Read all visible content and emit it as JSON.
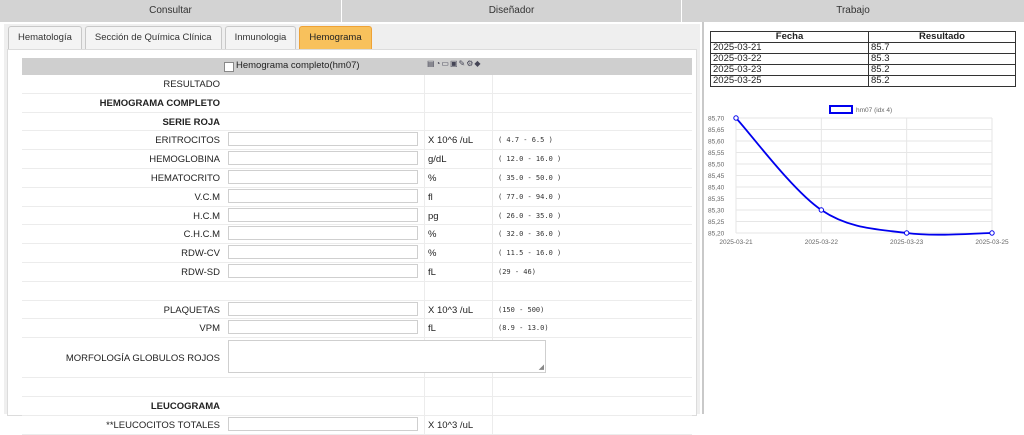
{
  "sections": [
    "Consultar",
    "Diseñador",
    "Trabajo"
  ],
  "tabs": [
    {
      "label": "Hematología"
    },
    {
      "label": "Sección de Química Clínica"
    },
    {
      "label": "Inmunologia"
    },
    {
      "label": "Hemograma"
    }
  ],
  "active_tab": "Hemograma",
  "form": {
    "title": "Hemograma completo(hm07)",
    "rows": [
      {
        "label": "RESULTADO",
        "bold": false,
        "type": "label"
      },
      {
        "label": "HEMOGRAMA COMPLETO",
        "bold": true,
        "type": "label"
      },
      {
        "label": "SERIE ROJA",
        "bold": true,
        "type": "label"
      },
      {
        "label": "ERITROCITOS",
        "type": "input",
        "unit": "X 10^6 /uL",
        "ref": "( 4.7 - 6.5 )"
      },
      {
        "label": "HEMOGLOBINA",
        "type": "input",
        "unit": "g/dL",
        "ref": "( 12.0 - 16.0 )"
      },
      {
        "label": "HEMATOCRITO",
        "type": "input",
        "unit": "%",
        "ref": "( 35.0 - 50.0 )"
      },
      {
        "label": "V.C.M",
        "type": "input",
        "unit": "fl",
        "ref": "( 77.0 - 94.0 )"
      },
      {
        "label": "H.C.M",
        "type": "input",
        "unit": "pg",
        "ref": "( 26.0 - 35.0 )"
      },
      {
        "label": "C.H.C.M",
        "type": "input",
        "unit": "%",
        "ref": "( 32.0 - 36.0 )"
      },
      {
        "label": "RDW-CV",
        "type": "input",
        "unit": "%",
        "ref": "( 11.5 - 16.0 )"
      },
      {
        "label": "RDW-SD",
        "type": "input",
        "unit": "fL",
        "ref": "(29 - 46)"
      },
      {
        "label": "",
        "type": "blank"
      },
      {
        "label": "PLAQUETAS",
        "type": "input",
        "unit": "X 10^3 /uL",
        "ref": "(150 - 500)"
      },
      {
        "label": "VPM",
        "type": "input",
        "unit": "fL",
        "ref": "(8.9 - 13.0)"
      },
      {
        "label": "MORFOLOGÍA GLOBULOS ROJOS",
        "type": "textarea"
      },
      {
        "label": "",
        "type": "blank"
      },
      {
        "label": "LEUCOGRAMA",
        "bold": true,
        "type": "label"
      },
      {
        "label": "**LEUCOCITOS TOTALES",
        "type": "input",
        "unit": "X 10^3 /uL",
        "ref": ""
      }
    ]
  },
  "results": {
    "headers": [
      "Fecha",
      "Resultado"
    ],
    "rows": [
      [
        "2025-03-21",
        "85.7"
      ],
      [
        "2025-03-22",
        "85.3"
      ],
      [
        "2025-03-23",
        "85.2"
      ],
      [
        "2025-03-25",
        "85.2"
      ]
    ]
  },
  "chart_data": {
    "type": "line",
    "legend": "hm07 (idx 4)",
    "legend_position": "top",
    "x": [
      "2025-03-21",
      "2025-03-22",
      "2025-03-23",
      "2025-03-25"
    ],
    "series": [
      {
        "name": "hm07 (idx 4)",
        "values": [
          85.7,
          85.3,
          85.2,
          85.2
        ]
      }
    ],
    "yticks": [
      "85,70",
      "85,65",
      "85,60",
      "85,55",
      "85,50",
      "85,45",
      "85,40",
      "85,35",
      "85,30",
      "85,25",
      "85,20"
    ],
    "ylim": [
      85.2,
      85.7
    ],
    "grid": true,
    "color": "#0000ee"
  }
}
